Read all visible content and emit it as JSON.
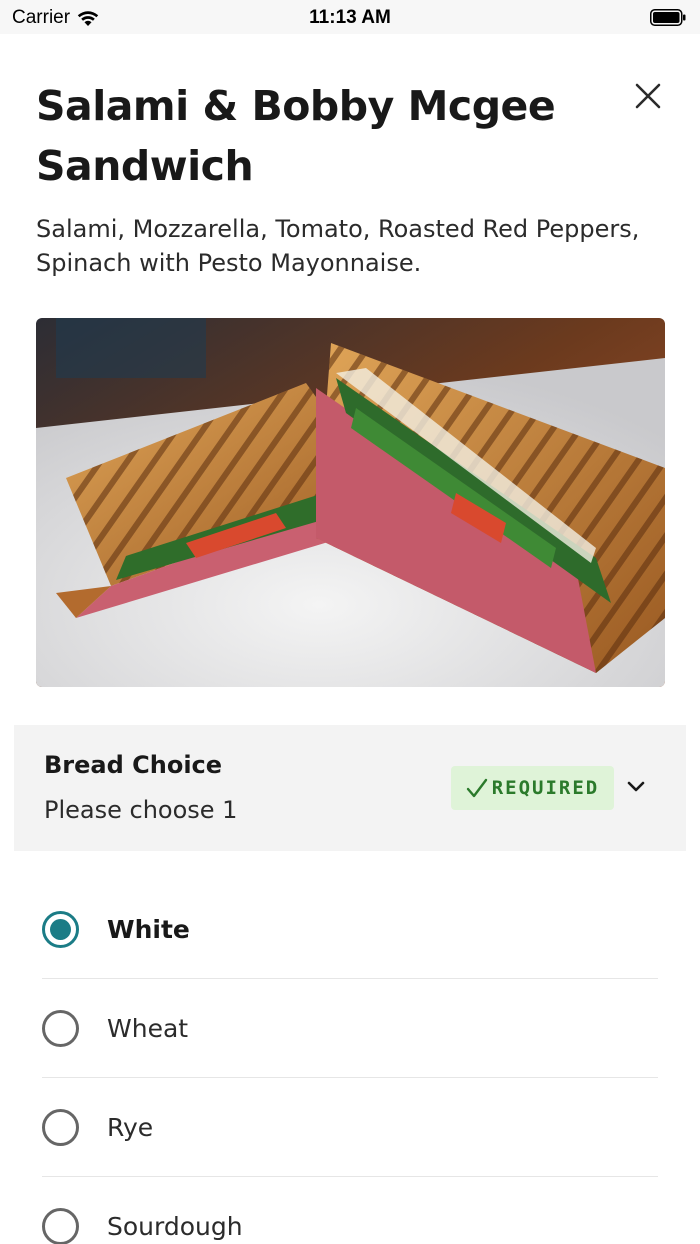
{
  "status_bar": {
    "carrier": "Carrier",
    "time": "11:13 AM"
  },
  "item": {
    "title": "Salami & Bobby Mcgee Sandwich",
    "description": "Salami, Mozzarella, Tomato, Roasted Red Peppers, Spinach with Pesto Mayonnaise."
  },
  "modifier_group": {
    "title": "Bread Choice",
    "subtitle": "Please choose 1",
    "badge": "REQUIRED",
    "options": [
      {
        "label": "White",
        "selected": true
      },
      {
        "label": "Wheat",
        "selected": false
      },
      {
        "label": "Rye",
        "selected": false
      },
      {
        "label": "Sourdough",
        "selected": false
      }
    ]
  },
  "colors": {
    "accent": "#1b7c86",
    "badge_bg": "#dff3d8",
    "badge_text": "#2b7a2b",
    "group_bg": "#f3f3f3"
  },
  "icons": [
    "wifi-icon",
    "battery-icon",
    "close-icon",
    "check-icon",
    "chevron-down-icon",
    "radio-icon"
  ]
}
